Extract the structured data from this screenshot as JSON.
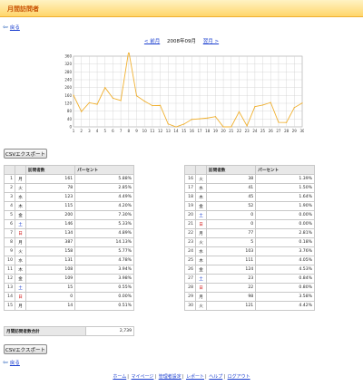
{
  "header": {
    "title": "月間訪問者"
  },
  "nav": {
    "back_label": "戻る",
    "prev_label": "< 前月",
    "current": "2008年09月",
    "next_label": "翌月 >"
  },
  "colors": {
    "line": "#f0b030",
    "grid": "#cfcfcf",
    "accent": "#ffd66b"
  },
  "chart_data": {
    "type": "line",
    "x": [
      1,
      2,
      3,
      4,
      5,
      6,
      7,
      8,
      9,
      10,
      11,
      12,
      13,
      14,
      15,
      16,
      17,
      18,
      19,
      20,
      21,
      22,
      23,
      24,
      25,
      26,
      27,
      28,
      29,
      30
    ],
    "series": [
      {
        "values": [
          161,
          78,
          123,
          115,
          200,
          146,
          134,
          387,
          158,
          131,
          108,
          109,
          15,
          0,
          14,
          38,
          41,
          45,
          52,
          0,
          0,
          77,
          5,
          103,
          111,
          124,
          23,
          22,
          98,
          121
        ]
      }
    ],
    "ylim": [
      0,
      360
    ],
    "yticks": [
      0,
      40,
      80,
      120,
      160,
      200,
      240,
      280,
      320,
      360
    ],
    "xticks": [
      "1",
      "2",
      "3",
      "4",
      "5",
      "6",
      "7",
      "8",
      "9",
      "10",
      "11",
      "12",
      "13",
      "14",
      "15",
      "16",
      "17",
      "18",
      "19",
      "20",
      "21",
      "22",
      "23",
      "24",
      "25",
      "26",
      "27",
      "28",
      "29",
      "30"
    ],
    "grid": true
  },
  "table": {
    "headers": [
      "訪問者数",
      "パーセント"
    ],
    "left": [
      {
        "day": "1",
        "wd": "月",
        "count": "161",
        "pct": "5.88%",
        "color": ""
      },
      {
        "day": "2",
        "wd": "火",
        "count": "78",
        "pct": "2.85%",
        "color": ""
      },
      {
        "day": "3",
        "wd": "水",
        "count": "123",
        "pct": "4.49%",
        "color": ""
      },
      {
        "day": "4",
        "wd": "木",
        "count": "115",
        "pct": "4.20%",
        "color": ""
      },
      {
        "day": "5",
        "wd": "金",
        "count": "200",
        "pct": "7.30%",
        "color": ""
      },
      {
        "day": "6",
        "wd": "土",
        "count": "146",
        "pct": "5.33%",
        "color": "blue"
      },
      {
        "day": "7",
        "wd": "日",
        "count": "134",
        "pct": "4.89%",
        "color": "red"
      },
      {
        "day": "8",
        "wd": "月",
        "count": "387",
        "pct": "14.13%",
        "color": ""
      },
      {
        "day": "9",
        "wd": "火",
        "count": "158",
        "pct": "5.77%",
        "color": ""
      },
      {
        "day": "10",
        "wd": "水",
        "count": "131",
        "pct": "4.78%",
        "color": ""
      },
      {
        "day": "11",
        "wd": "木",
        "count": "108",
        "pct": "3.94%",
        "color": ""
      },
      {
        "day": "12",
        "wd": "金",
        "count": "109",
        "pct": "3.98%",
        "color": ""
      },
      {
        "day": "13",
        "wd": "土",
        "count": "15",
        "pct": "0.55%",
        "color": "blue"
      },
      {
        "day": "14",
        "wd": "日",
        "count": "0",
        "pct": "0.00%",
        "color": "red"
      },
      {
        "day": "15",
        "wd": "月",
        "count": "14",
        "pct": "0.51%",
        "color": ""
      }
    ],
    "right": [
      {
        "day": "16",
        "wd": "火",
        "count": "38",
        "pct": "1.39%",
        "color": ""
      },
      {
        "day": "17",
        "wd": "水",
        "count": "41",
        "pct": "1.50%",
        "color": ""
      },
      {
        "day": "18",
        "wd": "木",
        "count": "45",
        "pct": "1.64%",
        "color": ""
      },
      {
        "day": "19",
        "wd": "金",
        "count": "52",
        "pct": "1.90%",
        "color": ""
      },
      {
        "day": "20",
        "wd": "土",
        "count": "0",
        "pct": "0.00%",
        "color": "blue"
      },
      {
        "day": "21",
        "wd": "日",
        "count": "0",
        "pct": "0.00%",
        "color": "red"
      },
      {
        "day": "22",
        "wd": "月",
        "count": "77",
        "pct": "2.81%",
        "color": ""
      },
      {
        "day": "23",
        "wd": "火",
        "count": "5",
        "pct": "0.18%",
        "color": ""
      },
      {
        "day": "24",
        "wd": "水",
        "count": "103",
        "pct": "3.76%",
        "color": ""
      },
      {
        "day": "25",
        "wd": "木",
        "count": "111",
        "pct": "4.05%",
        "color": ""
      },
      {
        "day": "26",
        "wd": "金",
        "count": "124",
        "pct": "4.53%",
        "color": ""
      },
      {
        "day": "27",
        "wd": "土",
        "count": "23",
        "pct": "0.84%",
        "color": "blue"
      },
      {
        "day": "28",
        "wd": "日",
        "count": "22",
        "pct": "0.80%",
        "color": "red"
      },
      {
        "day": "29",
        "wd": "月",
        "count": "98",
        "pct": "3.58%",
        "color": ""
      },
      {
        "day": "30",
        "wd": "火",
        "count": "121",
        "pct": "4.42%",
        "color": ""
      }
    ],
    "total_label": "月間訪問者数合計",
    "total_value": "2,739"
  },
  "buttons": {
    "csv_label": "CSVエクスポート"
  },
  "footer": {
    "links": [
      "ホーム",
      "マイページ",
      "管理者設定",
      "レポート",
      "ヘルプ",
      "ログアウト"
    ]
  }
}
